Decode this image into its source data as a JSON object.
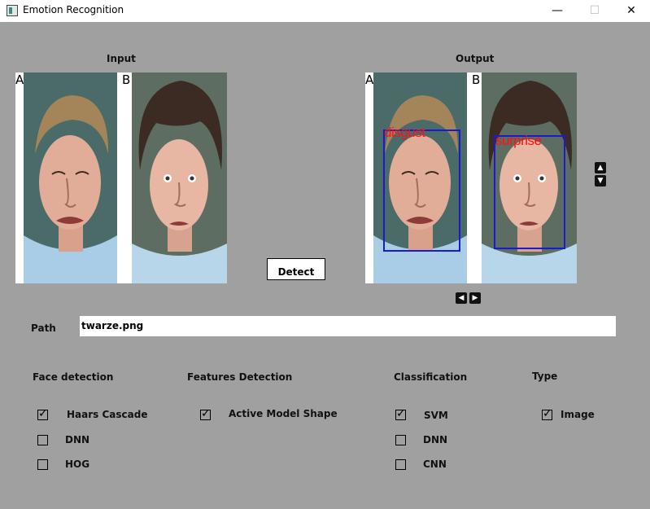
{
  "window": {
    "title": "Emotion Recognition",
    "minimize": "—",
    "maximize": "☐",
    "close": "✕"
  },
  "input": {
    "label": "Input",
    "panels": [
      {
        "letter": "A"
      },
      {
        "letter": "B"
      }
    ]
  },
  "output": {
    "label": "Output",
    "panels": [
      {
        "letter": "A",
        "emotion": "disgust"
      },
      {
        "letter": "B",
        "emotion": "surprise"
      }
    ]
  },
  "detect_button": "Detect",
  "nav": {
    "up": "▲",
    "down": "▼",
    "left": "◀",
    "right": "▶"
  },
  "path": {
    "label": "Path",
    "value": "twarze.png"
  },
  "groups": {
    "face_detection": {
      "label": "Face detection",
      "options": [
        {
          "label": "Haars Cascade",
          "checked": true
        },
        {
          "label": "DNN",
          "checked": false
        },
        {
          "label": "HOG",
          "checked": false
        }
      ]
    },
    "features_detection": {
      "label": "Features Detection",
      "options": [
        {
          "label": "Active Model Shape",
          "checked": true
        }
      ]
    },
    "classification": {
      "label": "Classification",
      "options": [
        {
          "label": "SVM",
          "checked": true
        },
        {
          "label": "DNN",
          "checked": false
        },
        {
          "label": "CNN",
          "checked": false
        }
      ]
    },
    "type": {
      "label": "Type",
      "options": [
        {
          "label": "Image",
          "checked": true
        }
      ]
    }
  },
  "colors": {
    "background": "#a0a0a0",
    "bbox": "#1a1ad0",
    "emotion_text": "#ff1010"
  },
  "icons": {
    "app": "app-icon",
    "face_photo": "face-photo"
  }
}
